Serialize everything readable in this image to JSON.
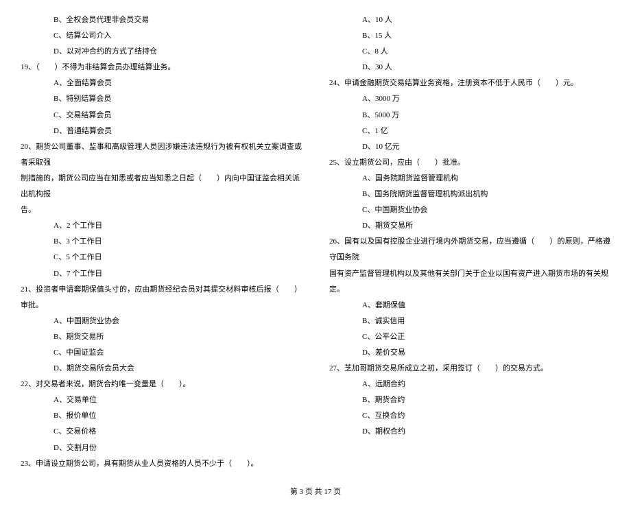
{
  "left": {
    "q18_opts": [
      {
        "label": "B、全权会员代理非会员交易"
      },
      {
        "label": "C、结算公司介入"
      },
      {
        "label": "D、以对冲合约的方式了结持仓"
      }
    ],
    "q19": "19、（　　）不得为非结算会员办理结算业务。",
    "q19_opts": [
      {
        "label": "A、全面结算会员"
      },
      {
        "label": "B、特别结算会员"
      },
      {
        "label": "C、交易结算会员"
      },
      {
        "label": "D、普通结算会员"
      }
    ],
    "q20_l1": "20、期货公司董事、监事和高级管理人员因涉嫌违法违规行为被有权机关立案调查或者采取强",
    "q20_l2": "制措施的，期货公司应当在知悉或者应当知悉之日起（　　）内向中国证监会相关派出机构报",
    "q20_l3": "告。",
    "q20_opts": [
      {
        "label": "A、2 个工作日"
      },
      {
        "label": "B、3 个工作日"
      },
      {
        "label": "C、5 个工作日"
      },
      {
        "label": "D、7 个工作日"
      }
    ],
    "q21": "21、投资者申请套期保值头寸的，应由期货经纪会员对其提交材料审核后报（　　）审批。",
    "q21_opts": [
      {
        "label": "A、中国期货业协会"
      },
      {
        "label": "B、期货交易所"
      },
      {
        "label": "C、中国证监会"
      },
      {
        "label": "D、期货交易所会员大会"
      }
    ],
    "q22": "22、对交易者来说，期货合约唯一变量是（　　）。",
    "q22_opts": [
      {
        "label": "A、交易单位"
      },
      {
        "label": "B、报价单位"
      },
      {
        "label": "C、交易价格"
      },
      {
        "label": "D、交割月份"
      }
    ],
    "q23": "23、申请设立期货公司，具有期货从业人员资格的人员不少于（　　）。"
  },
  "right": {
    "q23_opts": [
      {
        "label": "A、10 人"
      },
      {
        "label": "B、15 人"
      },
      {
        "label": "C、8 人"
      },
      {
        "label": "D、30 人"
      }
    ],
    "q24": "24、申请金融期货交易结算业务资格，注册资本不低于人民币（　　）元。",
    "q24_opts": [
      {
        "label": "A、3000 万"
      },
      {
        "label": "B、5000 万"
      },
      {
        "label": "C、1 亿"
      },
      {
        "label": "D、10 亿元"
      }
    ],
    "q25": "25、设立期货公司，应由（　　）批准。",
    "q25_opts": [
      {
        "label": "A、国务院期货监督管理机构"
      },
      {
        "label": "B、国务院期货监督管理机构派出机构"
      },
      {
        "label": "C、中国期货业协会"
      },
      {
        "label": "D、期货交易所"
      }
    ],
    "q26_l1": "26、国有以及国有控股企业进行境内外期货交易，应当遵循（　　）的原则，严格遵守国务院",
    "q26_l2": "国有资产监督管理机构以及其他有关部门关于企业以国有资产进入期货市场的有关规定。",
    "q26_opts": [
      {
        "label": "A、套期保值"
      },
      {
        "label": "B、诚实信用"
      },
      {
        "label": "C、公平公正"
      },
      {
        "label": "D、差价交易"
      }
    ],
    "q27": "27、芝加哥期货交易所成立之初，采用签订（　　）的交易方式。",
    "q27_opts": [
      {
        "label": "A、远期合约"
      },
      {
        "label": "B、期货合约"
      },
      {
        "label": "C、互换合约"
      },
      {
        "label": "D、期权合约"
      }
    ]
  },
  "footer": "第 3 页 共 17 页"
}
